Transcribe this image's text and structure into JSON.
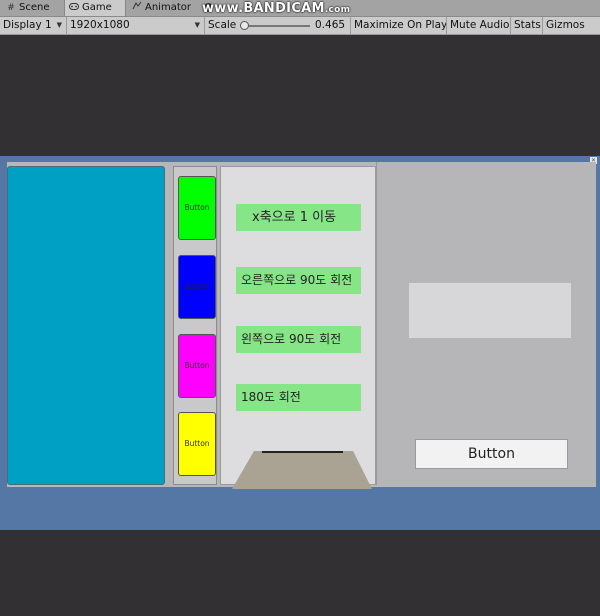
{
  "tabs": [
    {
      "icon": "hash-icon",
      "label": "Scene"
    },
    {
      "icon": "gamepad-icon",
      "label": "Game"
    },
    {
      "icon": "animator-icon",
      "label": "Animator"
    }
  ],
  "watermark": {
    "main": "www.BANDICAM",
    "suffix": ".com"
  },
  "toolbar": {
    "display": "Display 1",
    "resolution": "1920x1080",
    "scale_label": "Scale",
    "scale_value": "0.465",
    "maximize": "Maximize On Play",
    "mute": "Mute Audio",
    "stats": "Stats",
    "gizmos": "Gizmos"
  },
  "game": {
    "column_buttons": [
      {
        "label": "Button",
        "color": "#00ff00"
      },
      {
        "label": "Button",
        "color": "#0000ff"
      },
      {
        "label": "Button",
        "color": "#ff00ff"
      },
      {
        "label": "Button",
        "color": "#ffff00"
      }
    ],
    "labels": [
      "x축으로 1 이동",
      "오른쪽으로 90도 회전",
      "왼쪽으로 90도 회전",
      "180도 회전"
    ],
    "right_button": "Button",
    "colors": {
      "cyan_panel": "#00a0c4",
      "label_bg": "#86e587",
      "canvas_bg": "#b7b6b9"
    }
  }
}
